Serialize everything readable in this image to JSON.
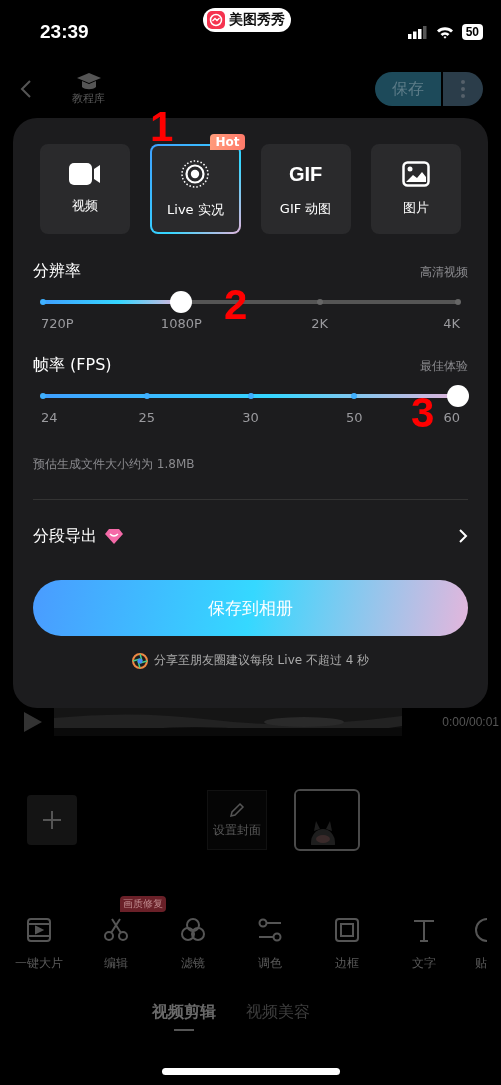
{
  "status_bar": {
    "time": "23:39",
    "app_pill": "美图秀秀",
    "battery": "50"
  },
  "header": {
    "tutorial": "教程库",
    "save": "保存"
  },
  "export_sheet": {
    "formats": [
      {
        "kind": "icon",
        "label": "视频",
        "selected": false
      },
      {
        "kind": "icon",
        "label": "Live 实况",
        "selected": true,
        "badge": "Hot"
      },
      {
        "kind": "glyph",
        "glyph": "GIF",
        "label": "GIF 动图",
        "selected": false
      },
      {
        "kind": "icon",
        "label": "图片",
        "selected": false
      }
    ],
    "sliders": [
      {
        "title": "分辨率",
        "hint": "高清视频",
        "level": 0.3333,
        "ticks": [
          "720P",
          "1080P",
          "2K",
          "4K"
        ]
      },
      {
        "title": "帧率 (FPS)",
        "hint": "最佳体验",
        "level": 1,
        "ticks": [
          "24",
          "25",
          "30",
          "50",
          "60"
        ]
      }
    ],
    "estimate": "预估生成文件大小约为 1.8MB",
    "segment_export": "分段导出",
    "save_button": "保存到相册",
    "note": "分享至朋友圈建议每段 Live 不超过 4 秒"
  },
  "annotations": [
    "1",
    "2",
    "3"
  ],
  "editor": {
    "timestamp": "0:00/00:01",
    "cover": "设置封面",
    "tools": [
      {
        "label": "一键大片"
      },
      {
        "label": "编辑",
        "badge": "画质修复"
      },
      {
        "label": "滤镜"
      },
      {
        "label": "调色"
      },
      {
        "label": "边框"
      },
      {
        "label": "文字"
      },
      {
        "label": "贴"
      }
    ],
    "tabs": [
      {
        "label": "视频剪辑",
        "selected": true
      },
      {
        "label": "视频美容",
        "selected": false
      }
    ]
  }
}
